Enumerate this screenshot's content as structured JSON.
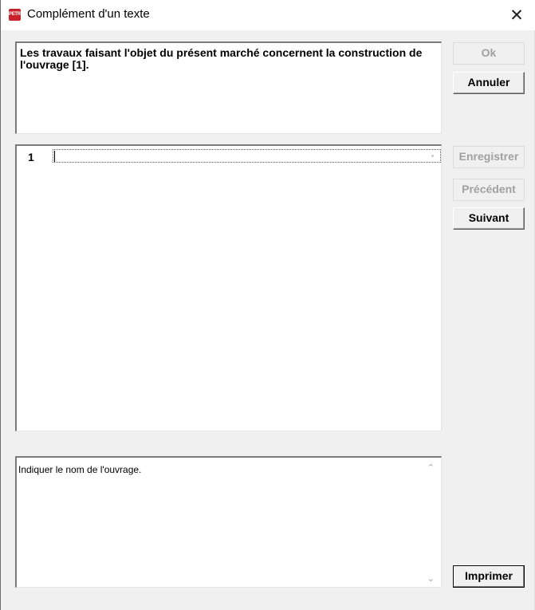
{
  "window": {
    "title": "Complément d'un texte",
    "icon_label": "PETRA",
    "close_glyph": "✕"
  },
  "text_panel": {
    "content": "Les travaux faisant l'objet du présent marché concernent la construction de l'ouvrage [1]."
  },
  "list": {
    "rows": [
      {
        "number": "1",
        "value": ""
      }
    ]
  },
  "help_panel": {
    "content": "Indiquer le nom de l'ouvrage.",
    "scroll_up_glyph": "⌃",
    "scroll_down_glyph": "⌄"
  },
  "buttons": {
    "ok": "Ok",
    "cancel": "Annuler",
    "save": "Enregistrer",
    "previous": "Précédent",
    "next": "Suivant",
    "print": "Imprimer"
  },
  "colors": {
    "background": "#f0f0f0",
    "icon_red": "#c8232c",
    "disabled_text": "#a0a0a0"
  }
}
